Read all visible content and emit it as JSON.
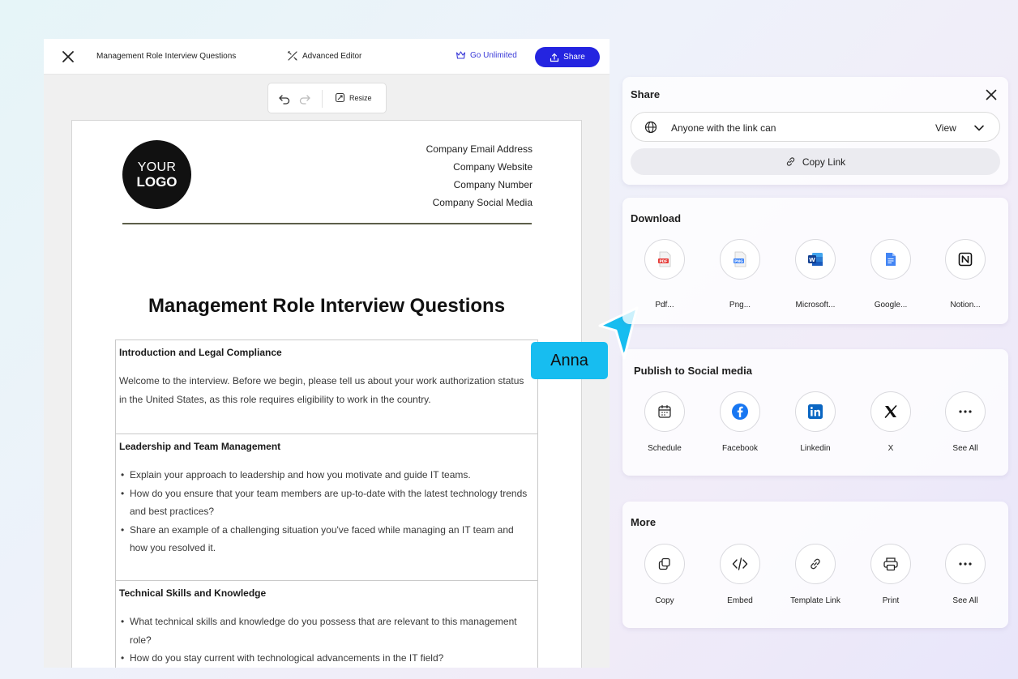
{
  "editor": {
    "title": "Management Role Interview Questions",
    "advanced_editor": "Advanced Editor",
    "go_unlimited": "Go Unlimited",
    "share_label": "Share",
    "resize_label": "Resize"
  },
  "document": {
    "logo_line1": "YOUR",
    "logo_line2": "LOGO",
    "company": [
      "Company Email Address",
      "Company Website",
      "Company Number",
      "Company Social Media"
    ],
    "title": "Management Role Interview Questions",
    "sections": [
      {
        "heading": "Introduction and Legal Compliance",
        "paragraph": "Welcome to the interview. Before we begin, please tell us about your work authorization status in the United States, as this role requires eligibility to work in the country."
      },
      {
        "heading": "Leadership and Team Management",
        "bullets": [
          "Explain your approach to leadership and how you motivate and guide IT teams.",
          "How do you ensure that your team members are up-to-date with the latest technology trends and best practices?",
          "Share an example of a challenging situation you've faced while managing an IT team and how you resolved it."
        ]
      },
      {
        "heading": "Technical Skills and Knowledge",
        "bullets": [
          "What technical skills and knowledge do you possess that are relevant to this management role?",
          "How do you stay current with technological advancements in the IT field?"
        ]
      }
    ]
  },
  "collaborator": {
    "name": "Anna",
    "color": "#17bdf0"
  },
  "share_panel": {
    "title": "Share",
    "access_text": "Anyone with the link can",
    "access_level": "View",
    "copy_link": "Copy Link"
  },
  "download": {
    "title": "Download",
    "items": [
      {
        "label": "Pdf...",
        "icon": "pdf-file-icon"
      },
      {
        "label": "Png...",
        "icon": "png-file-icon"
      },
      {
        "label": "Microsoft...",
        "icon": "microsoft-word-icon"
      },
      {
        "label": "Google...",
        "icon": "google-docs-icon"
      },
      {
        "label": "Notion...",
        "icon": "notion-icon"
      }
    ]
  },
  "social": {
    "title": "Publish to Social media",
    "items": [
      {
        "label": "Schedule",
        "icon": "calendar-icon"
      },
      {
        "label": "Facebook",
        "icon": "facebook-icon"
      },
      {
        "label": "Linkedin",
        "icon": "linkedin-icon"
      },
      {
        "label": "X",
        "icon": "x-logo-icon"
      },
      {
        "label": "See All",
        "icon": "more-dots-icon"
      }
    ]
  },
  "more": {
    "title": "More",
    "items": [
      {
        "label": "Copy",
        "icon": "copy-icon"
      },
      {
        "label": "Embed",
        "icon": "code-icon"
      },
      {
        "label": "Template Link",
        "icon": "link-icon"
      },
      {
        "label": "Print",
        "icon": "printer-icon"
      },
      {
        "label": "See All",
        "icon": "more-dots-icon"
      }
    ]
  },
  "colors": {
    "accent": "#2424e0",
    "facebook": "#1877f2",
    "linkedin": "#0a66c2",
    "pdf": "#e53935",
    "png": "#3b82f6",
    "word": "#185abd",
    "gdocs": "#4285f4"
  }
}
